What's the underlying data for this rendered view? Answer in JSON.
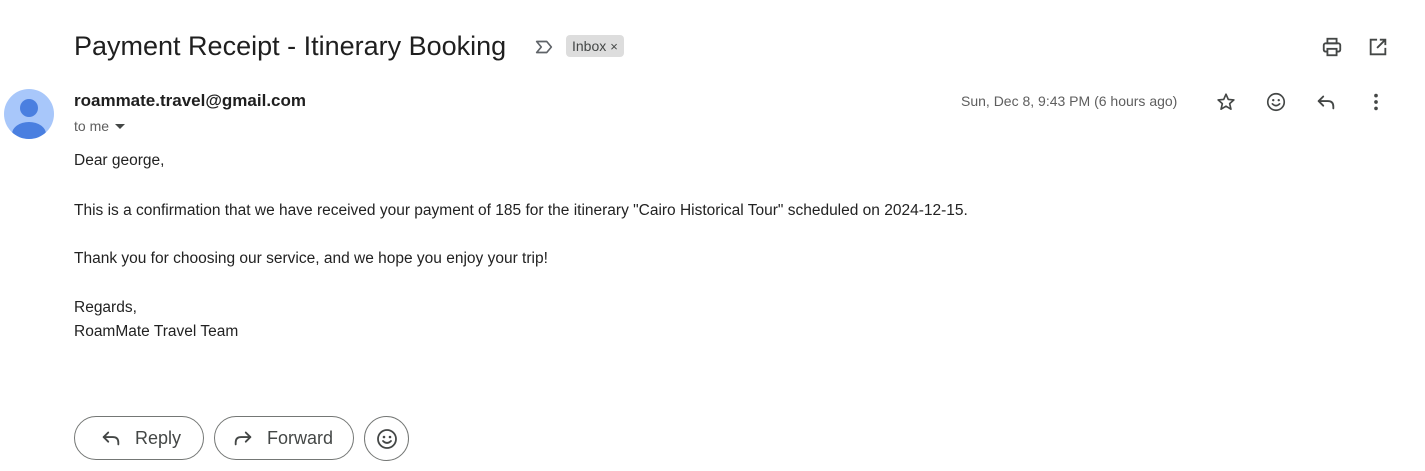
{
  "email": {
    "subject": "Payment Receipt - Itinerary Booking",
    "label": "Inbox",
    "label_remove_glyph": "×",
    "sender": "roammate.travel@gmail.com",
    "recipient_text": "to me",
    "date": "Sun, Dec 8, 9:43 PM (6 hours ago)",
    "body": {
      "greeting": "Dear george,",
      "confirmation": "This is a confirmation that we have received your payment of 185 for the itinerary \"Cairo Historical Tour\" scheduled on 2024-12-15.",
      "thanks": "Thank you for choosing our service, and we hope you enjoy your trip!",
      "signoff": "Regards,",
      "signature": "RoamMate Travel Team"
    }
  },
  "actions": {
    "reply_label": "Reply",
    "forward_label": "Forward"
  },
  "icons": {
    "header": [
      "important-marker-icon",
      "print-icon",
      "open-in-new-window-icon"
    ],
    "message": [
      "star-icon",
      "emoji-reaction-icon",
      "reply-icon",
      "more-vert-icon"
    ],
    "footer": [
      "reply-icon",
      "forward-icon",
      "emoji-reaction-icon"
    ]
  },
  "colors": {
    "avatar_bg": "#a8c7fa",
    "avatar_fg": "#4a7fe0",
    "label_chip_bg": "#dddddd",
    "text_primary": "#1f1f1f",
    "text_secondary": "#5e5e5e",
    "pill_border": "#747775"
  }
}
